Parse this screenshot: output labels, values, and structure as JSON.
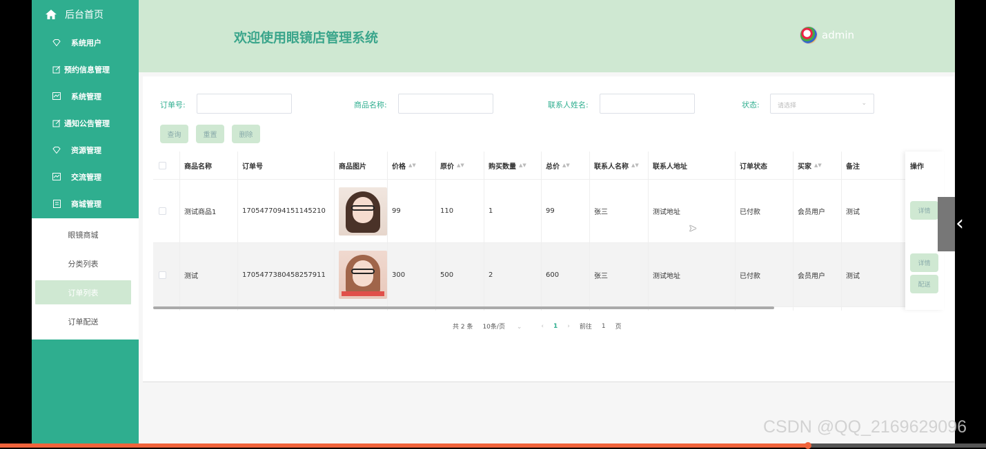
{
  "sidebar": {
    "home": "后台首页",
    "menu": [
      "系统用户",
      "预约信息管理",
      "系统管理",
      "通知公告管理",
      "资源管理",
      "交流管理",
      "商城管理"
    ],
    "submenu": [
      "眼镜商城",
      "分类列表",
      "订单列表",
      "订单配送"
    ]
  },
  "header": {
    "title": "欢迎使用眼镜店管理系统",
    "user": "admin"
  },
  "search": {
    "order_label": "订单号:",
    "product_label": "商品名称:",
    "contact_label": "联系人姓名:",
    "status_label": "状态:",
    "status_placeholder": "请选择"
  },
  "buttons": {
    "query": "查询",
    "reset": "重置",
    "delete": "删除"
  },
  "table": {
    "headers": [
      "商品名称",
      "订单号",
      "商品图片",
      "价格",
      "原价",
      "购买数量",
      "总价",
      "联系人名称",
      "联系人地址",
      "订单状态",
      "买家",
      "备注",
      "操作"
    ],
    "rows": [
      {
        "name": "测试商品1",
        "order": "1705477094151145210",
        "price": "99",
        "orig": "110",
        "qty": "1",
        "total": "99",
        "contact": "张三",
        "addr": "测试地址",
        "status": "已付款",
        "buyer": "会员用户",
        "note": "测试",
        "actions": [
          "详情"
        ]
      },
      {
        "name": "测试",
        "order": "1705477380458257911",
        "price": "300",
        "orig": "500",
        "qty": "2",
        "total": "600",
        "contact": "张三",
        "addr": "测试地址",
        "status": "已付款",
        "buyer": "会员用户",
        "note": "测试",
        "actions": [
          "详情",
          "配送"
        ]
      }
    ]
  },
  "pager": {
    "total": "共 2 条",
    "size": "10条/页",
    "current": "1",
    "goto_label": "前往",
    "goto_value": "1",
    "page_unit": "页"
  },
  "watermark": "CSDN @QQ_2169629096",
  "colors": {
    "accent": "#2fae8f",
    "header_bg": "#cfe8d2"
  }
}
